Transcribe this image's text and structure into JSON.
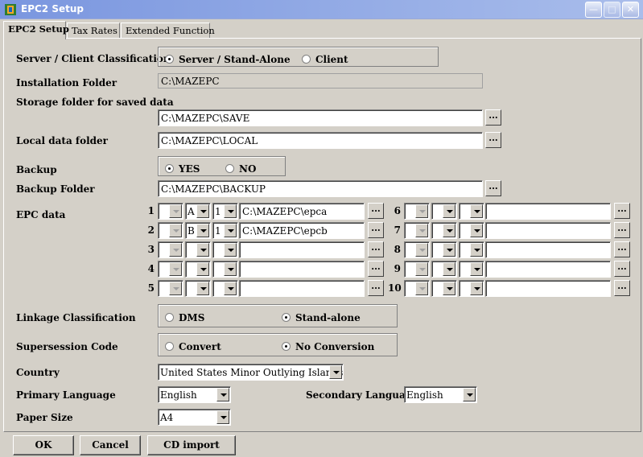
{
  "window": {
    "title": "EPC2 Setup"
  },
  "tabs": [
    {
      "label": "EPC2 Setup"
    },
    {
      "label": "Tax Rates"
    },
    {
      "label": "Extended Function"
    }
  ],
  "server": {
    "label": "Server / Client Classification",
    "options": [
      "Server / Stand-Alone",
      "Client"
    ],
    "selected": "Server / Stand-Alone"
  },
  "install": {
    "label": "Installation Folder",
    "value": "C:\\MAZEPC"
  },
  "storage": {
    "label": "Storage folder for saved data",
    "value": "C:\\MAZEPC\\SAVE"
  },
  "local": {
    "label": "Local data folder",
    "value": "C:\\MAZEPC\\LOCAL"
  },
  "backup": {
    "label": "Backup",
    "options": [
      "YES",
      "NO"
    ],
    "selected": "YES"
  },
  "backup_folder": {
    "label": "Backup Folder",
    "value": "C:\\MAZEPC\\BACKUP"
  },
  "browse_label": "...",
  "epc": {
    "label": "EPC data",
    "rows": [
      {
        "num": "1",
        "c1": "",
        "c2": "A",
        "c3": "1",
        "path": "C:\\MAZEPC\\epca"
      },
      {
        "num": "2",
        "c1": "",
        "c2": "B",
        "c3": "1",
        "path": "C:\\MAZEPC\\epcb"
      },
      {
        "num": "3",
        "c1": "",
        "c2": "",
        "c3": "",
        "path": ""
      },
      {
        "num": "4",
        "c1": "",
        "c2": "",
        "c3": "",
        "path": ""
      },
      {
        "num": "5",
        "c1": "",
        "c2": "",
        "c3": "",
        "path": ""
      },
      {
        "num": "6",
        "c1": "",
        "c2": "",
        "c3": "",
        "path": ""
      },
      {
        "num": "7",
        "c1": "",
        "c2": "",
        "c3": "",
        "path": ""
      },
      {
        "num": "8",
        "c1": "",
        "c2": "",
        "c3": "",
        "path": ""
      },
      {
        "num": "9",
        "c1": "",
        "c2": "",
        "c3": "",
        "path": ""
      },
      {
        "num": "10",
        "c1": "",
        "c2": "",
        "c3": "",
        "path": ""
      }
    ]
  },
  "linkage": {
    "label": "Linkage Classification",
    "options": [
      "DMS",
      "Stand-alone"
    ],
    "selected": "Stand-alone"
  },
  "supersession": {
    "label": "Supersession Code",
    "options": [
      "Convert",
      "No Conversion"
    ],
    "selected": "No Conversion"
  },
  "country": {
    "label": "Country",
    "value": "United States Minor Outlying Islands"
  },
  "primary_language": {
    "label": "Primary Language",
    "value": "English"
  },
  "secondary_language": {
    "label": "Secondary Language",
    "value": "English"
  },
  "paper": {
    "label": "Paper Size",
    "value": "A4"
  },
  "buttons": {
    "ok": "OK",
    "cancel": "Cancel",
    "cd_import": "CD import"
  }
}
